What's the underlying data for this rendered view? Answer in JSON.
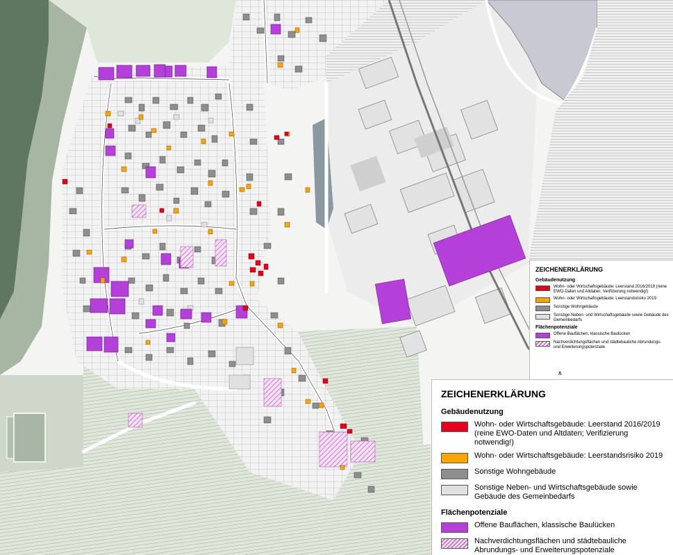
{
  "map": {
    "colors": {
      "vacant": "#e8001b",
      "risk": "#fba600",
      "residential": "#8e8e8e",
      "other": "#e0e0e0",
      "open_plots": "#b43fd9",
      "redensification": "#d36fd6",
      "river": "#c9c9d4",
      "forest": "#5f7760",
      "field": "#e3e7df"
    }
  },
  "legend_small": {
    "title": "ZEICHENERKLÄRUNG",
    "section_buildings": "Gebäudenutzung",
    "items_buildings": [
      {
        "color": "#e8001b",
        "label": "Wohn- oder Wirtschaftsgebäude: Leerstand 2016/2019 (reine EWO-Daten und Altdaten; Verifizierung notwendig!)"
      },
      {
        "color": "#fba600",
        "label": "Wohn- oder Wirtschaftsgebäude: Leerstandsrisiko 2019"
      },
      {
        "color": "#8e8e8e",
        "label": "Sonstige Wohngebäude"
      },
      {
        "color": "#e0e0e0",
        "label": "Sonstige Neben- und Wirtschaftsgebäude sowie Gebäude des Gemeinbedarfs"
      }
    ],
    "section_areas": "Flächenpotenziale",
    "items_areas": [
      {
        "color": "#b43fd9",
        "label": "Offene Bauflächen, klassische Baulücken"
      },
      {
        "color": "hatch",
        "label": "Nachverdichtungsflächen und städtebauliche Abrundungs- und Erweiterungspotenziale"
      }
    ],
    "caret": "∧"
  },
  "legend": {
    "title": "ZEICHENERKLÄRUNG",
    "section_buildings": "Gebäudenutzung",
    "vacant_label": "Wohn- oder Wirtschaftsgebäude: Leerstand 2016/2019 (reine EWO-Daten und Altdaten; Verifizierung notwendig!)",
    "risk_label": "Wohn- oder Wirtschaftsgebäude: Leerstandsrisiko 2019",
    "residential_label": "Sonstige Wohngebäude",
    "other_label": "Sonstige Neben- und Wirtschaftsgebäude sowie Gebäude des Gemeinbedarfs",
    "section_areas": "Flächenpotenziale",
    "open_plots_label": "Offene Bauflächen, klassische Baulücken",
    "redensification_label": "Nachverdichtungsflächen und städtebauliche Abrundungs- und Erweiterungspotenziale"
  }
}
